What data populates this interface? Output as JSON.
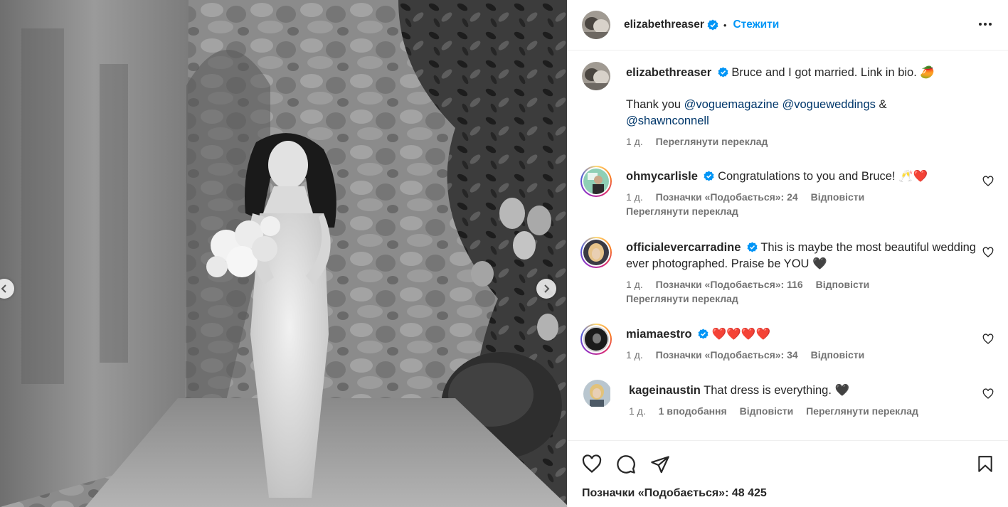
{
  "post": {
    "author": "elizabethreaser",
    "follow_label": "Стежити",
    "separator": "•"
  },
  "caption": {
    "author": "elizabethreaser",
    "line1": "Bruce and I got married. Link in bio. 🥭",
    "thanks_prefix": "Thank you",
    "mention1": "@voguemagazine",
    "mention2": "@vogueweddings",
    "ampersand": "&",
    "mention3": "@shawnconnell",
    "time": "1 д.",
    "translate": "Переглянути переклад"
  },
  "comments": [
    {
      "user": "ohmycarlisle",
      "text": "Congratulations to you and Bruce! 🥂❤️",
      "time": "1 д.",
      "likes": "Позначки «Подобається»: 24",
      "reply": "Відповісти",
      "translate": "Переглянути переклад"
    },
    {
      "user": "officialevercarradine",
      "text": "This is maybe the most beautiful wedding ever photographed. Praise be YOU 🖤",
      "time": "1 д.",
      "likes": "Позначки «Подобається»: 116",
      "reply": "Відповісти",
      "translate": "Переглянути переклад"
    },
    {
      "user": "miamaestro",
      "text": "❤️❤️❤️❤️",
      "time": "1 д.",
      "likes": "Позначки «Подобається»: 34",
      "reply": "Відповісти"
    },
    {
      "user": "kageinaustin",
      "text": "That dress is everything. 🖤",
      "time": "1 д.",
      "likes": "1 вподобання",
      "reply": "Відповісти",
      "translate": "Переглянути переклад"
    }
  ],
  "footer": {
    "likes_total": "Позначки «Подобається»: 48 425"
  },
  "icons": {
    "verified": "verified-badge-icon",
    "more": "more-options-icon",
    "like": "heart-icon",
    "comment": "comment-icon",
    "share": "share-icon",
    "save": "bookmark-icon",
    "prev": "chevron-left-icon",
    "next": "chevron-right-icon"
  },
  "colors": {
    "accent": "#0095f6",
    "verified": "#0095f6",
    "mention": "#00376b",
    "secondary_text": "#737373"
  }
}
